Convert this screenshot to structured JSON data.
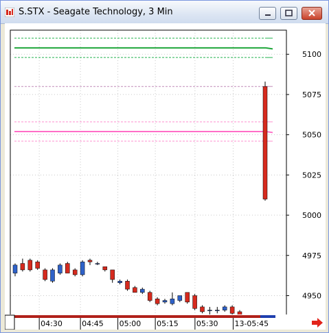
{
  "window": {
    "title": "S.STX - Seagate Technology, 3 Min"
  },
  "chart_data": {
    "type": "candlestick",
    "title": "S.STX - Seagate Technology, 3 Min",
    "y_axis_ticks": [
      "5100",
      "5075",
      "5050",
      "5025",
      "5000",
      "4975",
      "4950"
    ],
    "x_axis_ticks": [
      "04:30",
      "04:45",
      "05:00",
      "05:15",
      "05:30",
      "13-05:45"
    ],
    "ylim": [
      4937,
      5115
    ],
    "grid": true,
    "candles": [
      {
        "o": 4964,
        "h": 4970,
        "l": 4962,
        "c": 4969
      },
      {
        "o": 4970,
        "h": 4973,
        "l": 4965,
        "c": 4966
      },
      {
        "o": 4972,
        "h": 4973,
        "l": 4965,
        "c": 4966
      },
      {
        "o": 4971,
        "h": 4972,
        "l": 4966,
        "c": 4967
      },
      {
        "o": 4966,
        "h": 4967,
        "l": 4959,
        "c": 4960
      },
      {
        "o": 4959,
        "h": 4967,
        "l": 4958,
        "c": 4966
      },
      {
        "o": 4964,
        "h": 4970,
        "l": 4963,
        "c": 4969
      },
      {
        "o": 4970,
        "h": 4971,
        "l": 4964,
        "c": 4964
      },
      {
        "o": 4966,
        "h": 4967,
        "l": 4962,
        "c": 4963
      },
      {
        "o": 4963,
        "h": 4972,
        "l": 4962,
        "c": 4971
      },
      {
        "o": 4972,
        "h": 4973,
        "l": 4969,
        "c": 4971
      },
      {
        "o": 4970,
        "h": 4971,
        "l": 4969,
        "c": 4970
      },
      {
        "o": 4968,
        "h": 4968,
        "l": 4965,
        "c": 4966
      },
      {
        "o": 4966,
        "h": 4966,
        "l": 4958,
        "c": 4960
      },
      {
        "o": 4958,
        "h": 4960,
        "l": 4957,
        "c": 4959
      },
      {
        "o": 4959,
        "h": 4960,
        "l": 4953,
        "c": 4954
      },
      {
        "o": 4955,
        "h": 4956,
        "l": 4952,
        "c": 4952
      },
      {
        "o": 4952,
        "h": 4955,
        "l": 4951,
        "c": 4954
      },
      {
        "o": 4952,
        "h": 4953,
        "l": 4946,
        "c": 4947
      },
      {
        "o": 4948,
        "h": 4949,
        "l": 4944,
        "c": 4945
      },
      {
        "o": 4946,
        "h": 4948,
        "l": 4945,
        "c": 4947
      },
      {
        "o": 4945,
        "h": 4952,
        "l": 4944,
        "c": 4948
      },
      {
        "o": 4947,
        "h": 4950,
        "l": 4946,
        "c": 4950
      },
      {
        "o": 4952,
        "h": 4952,
        "l": 4945,
        "c": 4946
      },
      {
        "o": 4950,
        "h": 4951,
        "l": 4941,
        "c": 4942
      },
      {
        "o": 4943,
        "h": 4944,
        "l": 4939,
        "c": 4940
      },
      {
        "o": 4941,
        "h": 4943,
        "l": 4937,
        "c": 4941
      },
      {
        "o": 4941,
        "h": 4943,
        "l": 4939,
        "c": 4941
      },
      {
        "o": 4941,
        "h": 4944,
        "l": 4940,
        "c": 4943
      },
      {
        "o": 4943,
        "h": 4944,
        "l": 4938,
        "c": 4939
      },
      {
        "o": 4940,
        "h": 4941,
        "l": 4937,
        "c": 4938
      },
      {
        "o": 5080,
        "h": 5083,
        "l": 5009,
        "c": 5010
      }
    ],
    "levels": [
      {
        "value": 5110,
        "style": "dashed",
        "color": "#22b14c"
      },
      {
        "value": 5104,
        "style": "solid",
        "color": "#1fa63a"
      },
      {
        "value": 5098,
        "style": "dashed",
        "color": "#22b14c"
      },
      {
        "value": 5080,
        "style": "dashed",
        "color": "#c08ab8"
      },
      {
        "value": 5058,
        "style": "dashed",
        "color": "#ff8fcf"
      },
      {
        "value": 5052,
        "style": "solid",
        "color": "#ff6ec7"
      },
      {
        "value": 5046,
        "style": "dashed",
        "color": "#ff8fcf"
      }
    ],
    "colors": {
      "up": "#2f62c9",
      "down": "#d62a1e",
      "wick": "#000000",
      "grid": "#c8c8c8"
    }
  }
}
